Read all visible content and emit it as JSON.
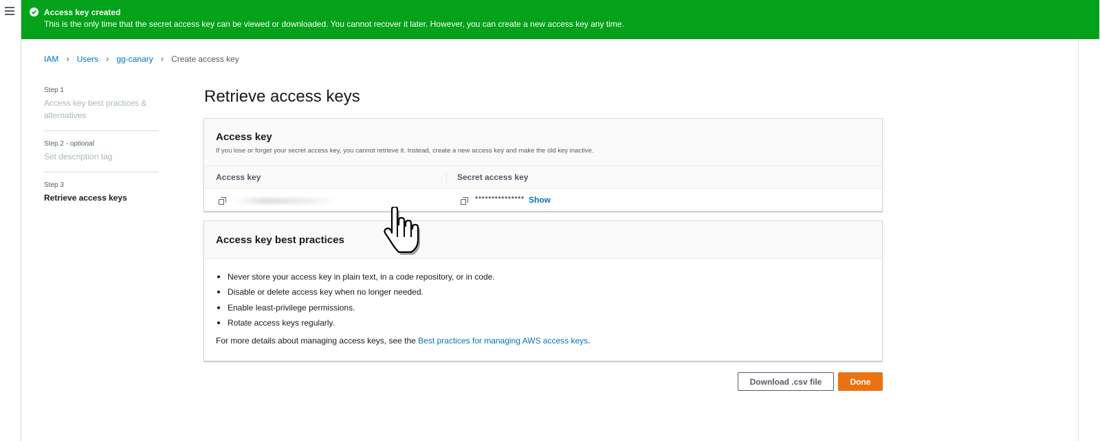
{
  "flash": {
    "title": "Access key created",
    "message": "This is the only time that the secret access key can be viewed or downloaded. You cannot recover it later. However, you can create a new access key any time.",
    "color": "#04a21a"
  },
  "breadcrumb": {
    "items": [
      "IAM",
      "Users",
      "gg-canary"
    ],
    "current": "Create access key"
  },
  "steps": [
    {
      "label": "Step 1",
      "optional": "",
      "title": "Access key best practices & alternatives"
    },
    {
      "label": "Step 2 - ",
      "optional": "optional",
      "title": "Set description tag"
    },
    {
      "label": "Step 3",
      "optional": "",
      "title": "Retrieve access keys"
    }
  ],
  "page_title": "Retrieve access keys",
  "access_key_panel": {
    "title": "Access key",
    "description": "If you lose or forget your secret access key, you cannot retrieve it. Instead, create a new access key and make the old key inactive.",
    "col_access_key": "Access key",
    "col_secret_key": "Secret access key",
    "secret_masked": "***************",
    "show_label": "Show"
  },
  "best_practices_panel": {
    "title": "Access key best practices",
    "items": [
      "Never store your access key in plain text, in a code repository, or in code.",
      "Disable or delete access key when no longer needed.",
      "Enable least-privilege permissions.",
      "Rotate access keys regularly."
    ],
    "more_prefix": "For more details about managing access keys, see the ",
    "more_link": "Best practices for managing AWS access keys",
    "more_suffix": "."
  },
  "buttons": {
    "download": "Download .csv file",
    "done": "Done",
    "done_color": "#ec7211"
  },
  "icons": {
    "menu": "hamburger-icon",
    "success": "check-circle-icon",
    "copy": "copy-icon",
    "cursor": "hand-pointer-cursor"
  }
}
